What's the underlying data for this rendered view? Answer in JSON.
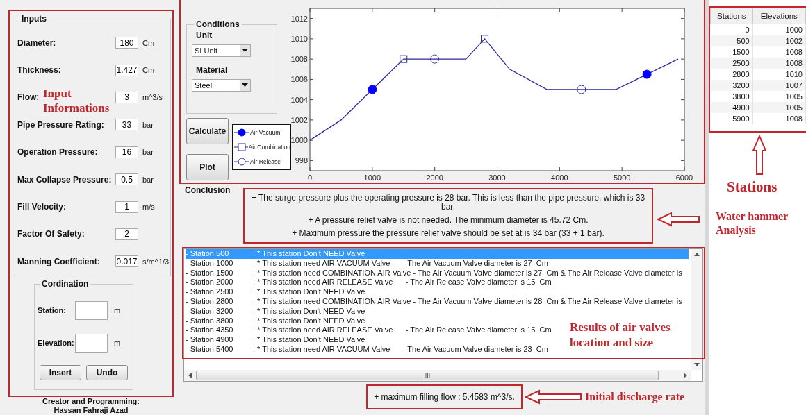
{
  "inputs": {
    "title": "Inputs",
    "fields": [
      {
        "label": "Diameter:",
        "value": "180",
        "unit": "Cm"
      },
      {
        "label": "Thickness:",
        "value": "1.427",
        "unit": "Cm"
      },
      {
        "label": "Flow:",
        "value": "3",
        "unit": "m^3/s"
      },
      {
        "label": "Pipe Pressure Rating:",
        "value": "33",
        "unit": "bar"
      },
      {
        "label": "Operation Pressure:",
        "value": "16",
        "unit": "bar"
      },
      {
        "label": "Max Collapse Pressure:",
        "value": "0.5",
        "unit": "bar"
      },
      {
        "label": "Fill Velocity:",
        "value": "1",
        "unit": "m/s"
      },
      {
        "label": "Factor Of Safety:",
        "value": "2"
      },
      {
        "label": "Manning Coefficient:",
        "value": "0.017",
        "unit": "s/m^1/3"
      }
    ]
  },
  "cordination": {
    "title": "Cordination",
    "fields": [
      {
        "label": "Station:",
        "unit": "m"
      },
      {
        "label": "Elevation:",
        "unit": "m"
      }
    ],
    "buttons": [
      "Insert",
      "Undo"
    ]
  },
  "credits": [
    "Creator and Programming:",
    "Hassan Fahraji Azad"
  ],
  "conditions": {
    "title": "Conditions",
    "dropdowns": [
      {
        "label": "Unit",
        "value": "SI Unit"
      },
      {
        "label": "Material",
        "value": "Steel"
      }
    ]
  },
  "actions": [
    "Calculate",
    "Plot"
  ],
  "profile": {
    "marker_styles": [
      {
        "filled": true
      },
      {
        "filled": false
      },
      {
        "filled": false
      }
    ],
    "chart_data": {
      "type": "line",
      "x": [
        0,
        500,
        1000,
        1500,
        2000,
        2500,
        2800,
        3200,
        3800,
        4350,
        4900,
        5400,
        5900
      ],
      "xlim": [
        0,
        6000
      ],
      "ylim": [
        997,
        1013
      ],
      "xticks": [
        0,
        1000,
        2000,
        3000,
        4000,
        5000,
        6000
      ],
      "yticks": [
        998,
        1000,
        1002,
        1004,
        1006,
        1008,
        1010,
        1012
      ],
      "series": [
        {
          "color": "#2a2a9a",
          "values": [
            1000,
            1002,
            1005,
            1008,
            1008,
            1008,
            1010,
            1007,
            1005,
            1005,
            1005,
            1006.5,
            1008
          ]
        },
        {
          "name": "Air Vacuum",
          "type": "scatter",
          "marker": "circle",
          "color": "#0000ff",
          "values": [
            null,
            null,
            1005,
            null,
            null,
            null,
            null,
            null,
            null,
            null,
            null,
            1006.5,
            null
          ]
        },
        {
          "name": "Air Combination",
          "type": "scatter",
          "marker": "square",
          "color": "#2a2a9a",
          "values": [
            null,
            null,
            null,
            1008,
            null,
            null,
            1010,
            null,
            null,
            null,
            null,
            null,
            null
          ]
        },
        {
          "name": "Air Release",
          "type": "scatter",
          "marker": "circle",
          "color": "#2a2a9a",
          "values": [
            null,
            null,
            null,
            null,
            1008,
            null,
            null,
            null,
            null,
            1005,
            null,
            null,
            null
          ]
        }
      ]
    }
  },
  "stations_table": {
    "columns": [
      "Stations",
      "Elevations"
    ],
    "rows": [
      [
        "0",
        "1000"
      ],
      [
        "500",
        "1002"
      ],
      [
        "1500",
        "1008"
      ],
      [
        "2500",
        "1008"
      ],
      [
        "2800",
        "1010"
      ],
      [
        "3200",
        "1007"
      ],
      [
        "3800",
        "1005"
      ],
      [
        "4900",
        "1005"
      ],
      [
        "5900",
        "1008"
      ]
    ]
  },
  "conclusion": {
    "title": "Conclusion",
    "lines": [
      "+ The surge pressure plus the operating pressure is 28 bar.  This is less than the pipe pressure, which is 33 bar.",
      "+ A pressure relief valve is not needed.  The minimum diameter is 45.72 Cm.",
      "+ Maximum pressure the pressure relief valve should be set at is 34 bar (33 + 1 bar)."
    ]
  },
  "results": [
    {
      "station": "- Station 500",
      "text": ": * This station Don't NEED Valve",
      "selected": true
    },
    {
      "station": "- Station 1000",
      "text": ": * This station need AIR VACUUM Valve      - The Air Vacuum Valve diameter is 27  Cm",
      "selected": false
    },
    {
      "station": "- Station 1500",
      "text": ": * This station need COMBINATION AIR Valve - The Air Vacuum Valve diameter is 27  Cm & The Air Release Valve diameter is",
      "selected": false
    },
    {
      "station": "- Station 2000",
      "text": ": * This station need AIR RELEASE Valve      - The Air Release Valve diameter is 15  Cm",
      "selected": false
    },
    {
      "station": "- Station 2500",
      "text": ": * This station Don't NEED Valve",
      "selected": false
    },
    {
      "station": "- Station 2800",
      "text": ": * This station need COMBINATION AIR Valve - The Air Vacuum Valve diameter is 28  Cm & The Air Release Valve diameter is",
      "selected": false
    },
    {
      "station": "- Station 3200",
      "text": ": * This station Don't NEED Valve",
      "selected": false
    },
    {
      "station": "- Station 3800",
      "text": ": * This station Don't NEED Valve",
      "selected": false
    },
    {
      "station": "- Station 4350",
      "text": ": * This station need AIR RELEASE Valve      - The Air Release Valve diameter is 15  Cm",
      "selected": false
    },
    {
      "station": "- Station 4900",
      "text": ": * This station Don't NEED Valve",
      "selected": false
    },
    {
      "station": "- Station 5400",
      "text": ": * This station need AIR VACUUM Valve      - The Air Vacuum Valve diameter is 23  Cm",
      "selected": false
    }
  ],
  "filling_flow": "+ maximum filling flow : 5.4583 m^3/s.",
  "annotations": {
    "inputs": "Input Informations",
    "stations": "Stations",
    "conclusion": "Water hammer Analysis",
    "results": "Results of air valves location and size",
    "filling_flow": "Initial discharge rate"
  }
}
